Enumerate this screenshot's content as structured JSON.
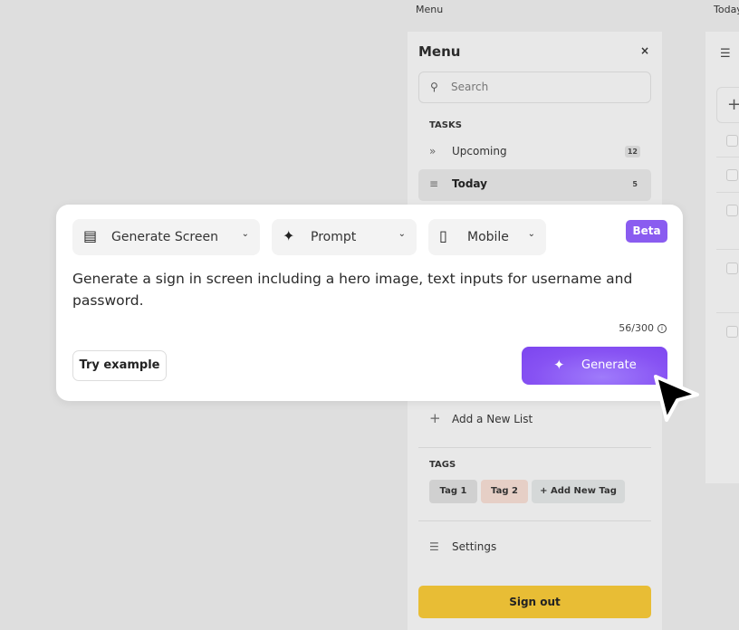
{
  "frame_labels": {
    "menu": "Menu",
    "today": "Today"
  },
  "sidebar": {
    "title": "Menu",
    "close_icon": "×",
    "search": {
      "icon": "search-icon",
      "placeholder": "Search"
    },
    "tasks_heading": "TASKS",
    "tasks": [
      {
        "label": "Upcoming",
        "icon": "double-chevron-right-icon",
        "count": "12"
      },
      {
        "label": "Today",
        "icon": "checklist-icon",
        "count": "5",
        "active": true
      }
    ],
    "add_list": "Add a New List",
    "tags_heading": "TAGS",
    "tags": [
      "Tag 1",
      "Tag 2",
      "+ Add New Tag"
    ],
    "settings": "Settings",
    "sign_out": "Sign out",
    "sign_out_color": "#e8bd35"
  },
  "generator": {
    "mode": "Generate Screen",
    "input_type": "Prompt",
    "device": "Mobile",
    "badge": "Beta",
    "prompt": "Generate a sign in screen including a hero image, text inputs for username and password.",
    "char_count": "56/300",
    "try_example": "Try example",
    "generate": "Generate",
    "accent_color": "#8752f3"
  }
}
